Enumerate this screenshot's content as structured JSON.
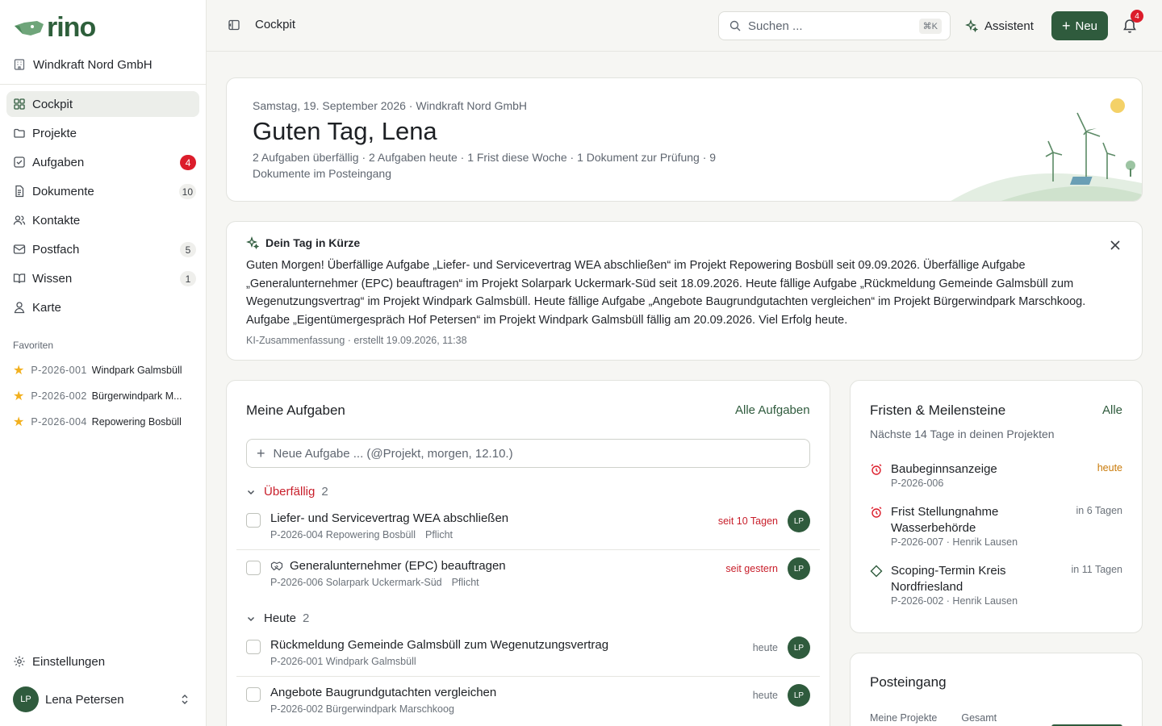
{
  "app": {
    "logo_text": "rino",
    "org_name": "Windkraft Nord GmbH"
  },
  "nav": [
    {
      "label": "Cockpit",
      "icon": "dashboard-icon",
      "active": true,
      "count": null
    },
    {
      "label": "Projekte",
      "icon": "folder-icon",
      "count": null
    },
    {
      "label": "Aufgaben",
      "icon": "task-check-icon",
      "count": "4",
      "count_style": "red"
    },
    {
      "label": "Dokumente",
      "icon": "document-icon",
      "count": "10"
    },
    {
      "label": "Kontakte",
      "icon": "contacts-icon",
      "count": null
    },
    {
      "label": "Postfach",
      "icon": "mail-icon",
      "count": "5"
    },
    {
      "label": "Wissen",
      "icon": "book-icon",
      "count": "1"
    },
    {
      "label": "Karte",
      "icon": "map-pin-icon",
      "count": null
    }
  ],
  "favorites": {
    "title": "Favoriten",
    "items": [
      {
        "code": "P-2026-001",
        "name": "Windpark Galmsbüll"
      },
      {
        "code": "P-2026-002",
        "name": "Bürgerwindpark M..."
      },
      {
        "code": "P-2026-004",
        "name": "Repowering Bosbüll"
      }
    ]
  },
  "settings_label": "Einstellungen",
  "user": {
    "initials": "LP",
    "name": "Lena Petersen"
  },
  "topbar": {
    "breadcrumb": "Cockpit",
    "search_placeholder": "Suchen ...",
    "search_shortcut": "⌘K",
    "assistant_label": "Assistent",
    "new_label": "Neu",
    "notifications_count": "4"
  },
  "hero": {
    "date_line": "Samstag, 19. September 2026 · Windkraft Nord GmbH",
    "greeting": "Guten Tag, Lena",
    "summary": "2 Aufgaben überfällig · 2 Aufgaben heute · 1 Frist diese Woche · 1 Dokument zur Prüfung · 9 Dokumente im Posteingang"
  },
  "briefing": {
    "title": "Dein Tag in Kürze",
    "text": "Guten Morgen! Überfällige Aufgabe „Liefer- und Servicevertrag WEA abschließen“ im Projekt Repowering Bosbüll seit 09.09.2026. Überfällige Aufgabe „Generalunternehmer (EPC) beauftragen“ im Projekt Solarpark Uckermark-Süd seit 18.09.2026. Heute fällige Aufgabe „Rückmeldung Gemeinde Galmsbüll zum Wegenutzungsvertrag“ im Projekt Windpark Galmsbüll. Heute fällige Aufgabe „Angebote Baugrundgutachten vergleichen“ im Projekt Bürgerwindpark Marschkoog. Aufgabe „Eigentümergespräch Hof Petersen“ im Projekt Windpark Galmsbüll fällig am 20.09.2026. Viel Erfolg heute.",
    "meta": "KI-Zusammenfassung · erstellt 19.09.2026, 11:38"
  },
  "tasks": {
    "title": "Meine Aufgaben",
    "all_link": "Alle Aufgaben",
    "new_placeholder": "Neue Aufgabe ... (@Projekt, morgen, 12.10.)",
    "groups": [
      {
        "label": "Überfällig",
        "count": "2",
        "color": "#c81e2a",
        "items": [
          {
            "title": "Liefer- und Servicevertrag WEA abschließen",
            "meta": "P-2026-004 Repowering Bosbüll",
            "tag": "Pflicht",
            "due": "seit 10 Tagen",
            "assignee": "LP",
            "icon": null
          },
          {
            "title": "Generalunternehmer (EPC) beauftragen",
            "meta": "P-2026-006 Solarpark Uckermark-Süd",
            "tag": "Pflicht",
            "due": "seit gestern",
            "assignee": "LP",
            "icon": "handshake-icon"
          }
        ]
      },
      {
        "label": "Heute",
        "count": "2",
        "color": "#1d2024",
        "items": [
          {
            "title": "Rückmeldung Gemeinde Galmsbüll zum Wegenutzungsvertrag",
            "meta": "P-2026-001 Windpark Galmsbüll",
            "tag": "",
            "due": "heute",
            "assignee": "LP",
            "icon": null
          },
          {
            "title": "Angebote Baugrundgutachten vergleichen",
            "meta": "P-2026-002 Bürgerwindpark Marschkoog",
            "tag": "",
            "due": "heute",
            "assignee": "LP",
            "icon": null
          }
        ]
      }
    ]
  },
  "deadlines": {
    "title": "Fristen & Meilensteine",
    "all_link": "Alle",
    "subtitle": "Nächste 14 Tage in deinen Projekten",
    "items": [
      {
        "title": "Baubeginnsanzeige",
        "meta": "P-2026-006",
        "when": "heute",
        "icon": "alarm-clock-icon"
      },
      {
        "title": "Frist Stellungnahme Wasserbehörde",
        "meta": "P-2026-007 · Henrik Lausen",
        "when": "in 6 Tagen",
        "icon": "alarm-clock-icon"
      },
      {
        "title": "Scoping-Termin Kreis Nordfriesland",
        "meta": "P-2026-002 · Henrik Lausen",
        "when": "in 11 Tagen",
        "icon": "milestone-diamond-icon"
      }
    ]
  },
  "inbox": {
    "title": "Posteingang",
    "tabs": [
      "Meine Projekte",
      "Gesamt"
    ]
  },
  "colors": {
    "brand": "#2f5b3d",
    "alert": "#dc1d2b",
    "warning": "#c97a09",
    "background": "#f6f6f3"
  }
}
